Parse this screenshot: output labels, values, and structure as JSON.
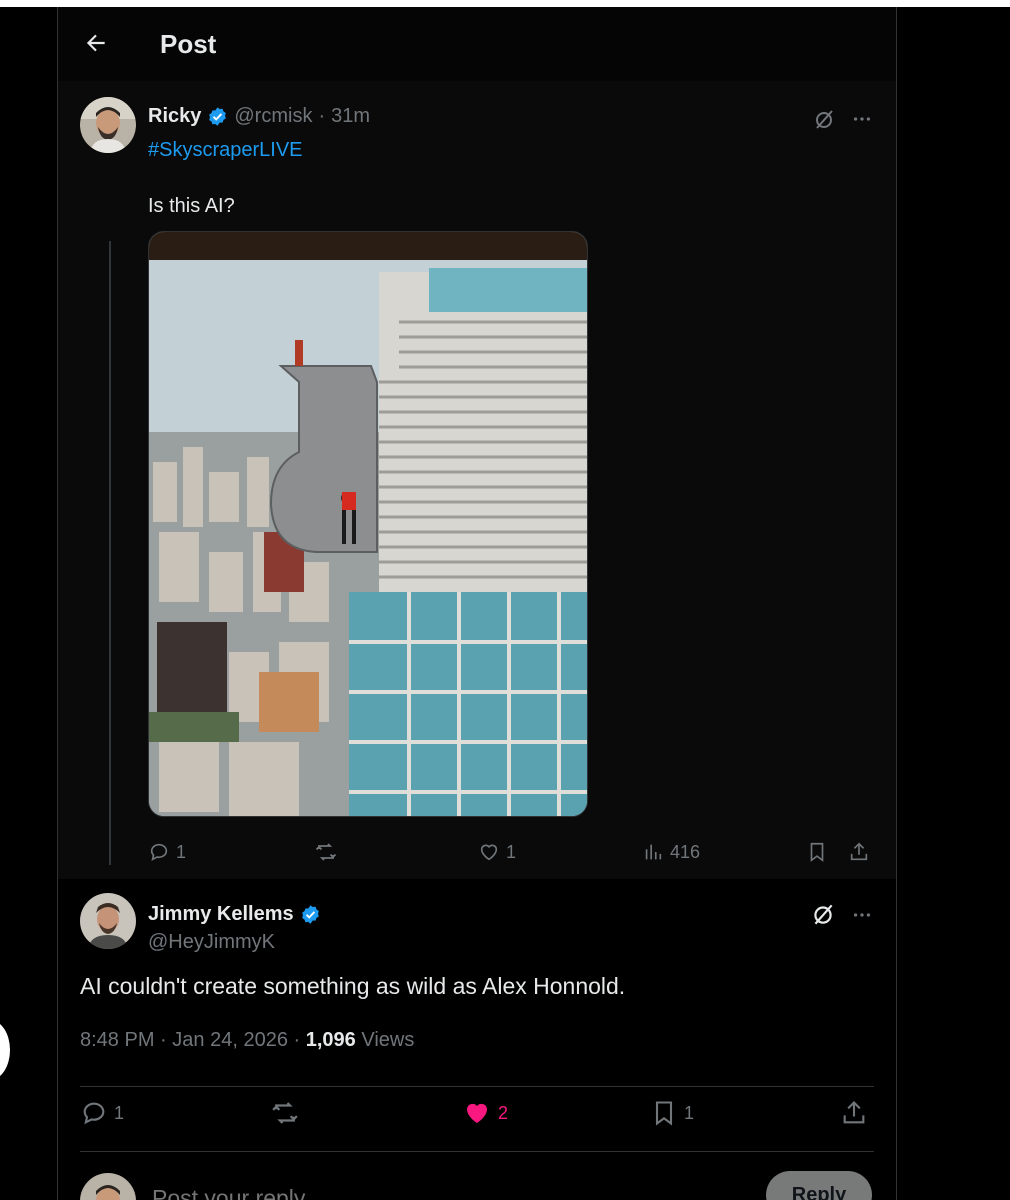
{
  "header": {
    "title": "Post"
  },
  "parent_post": {
    "display_name": "Ricky",
    "handle": "@rcmisk",
    "separator": "·",
    "time": "31m",
    "hashtag": "#SkyscraperLIVE",
    "text": "Is this AI?",
    "actions": {
      "replies": "1",
      "reposts": "",
      "likes": "1",
      "views": "416"
    }
  },
  "reply_post": {
    "display_name": "Jimmy Kellems",
    "handle": "@HeyJimmyK",
    "text": "AI couldn't create something as wild as Alex Honnold.",
    "time": "8:48 PM",
    "sep1": "·",
    "date": "Jan 24, 2026",
    "sep2": "·",
    "views_count": "1,096",
    "views_label": "Views",
    "actions": {
      "replies": "1",
      "reposts": "",
      "likes": "2",
      "bookmarks": "1"
    }
  },
  "composer": {
    "placeholder": "Post your reply",
    "button_label": "Reply"
  },
  "colors": {
    "accent": "#1d9bf0",
    "like": "#f91880",
    "muted": "#71767b",
    "text": "#e7e9ea"
  },
  "icons": [
    "back-arrow-icon",
    "verified-badge-icon",
    "grok-icon",
    "more-icon",
    "reply-icon",
    "repost-icon",
    "like-icon",
    "views-icon",
    "bookmark-icon",
    "share-icon"
  ]
}
